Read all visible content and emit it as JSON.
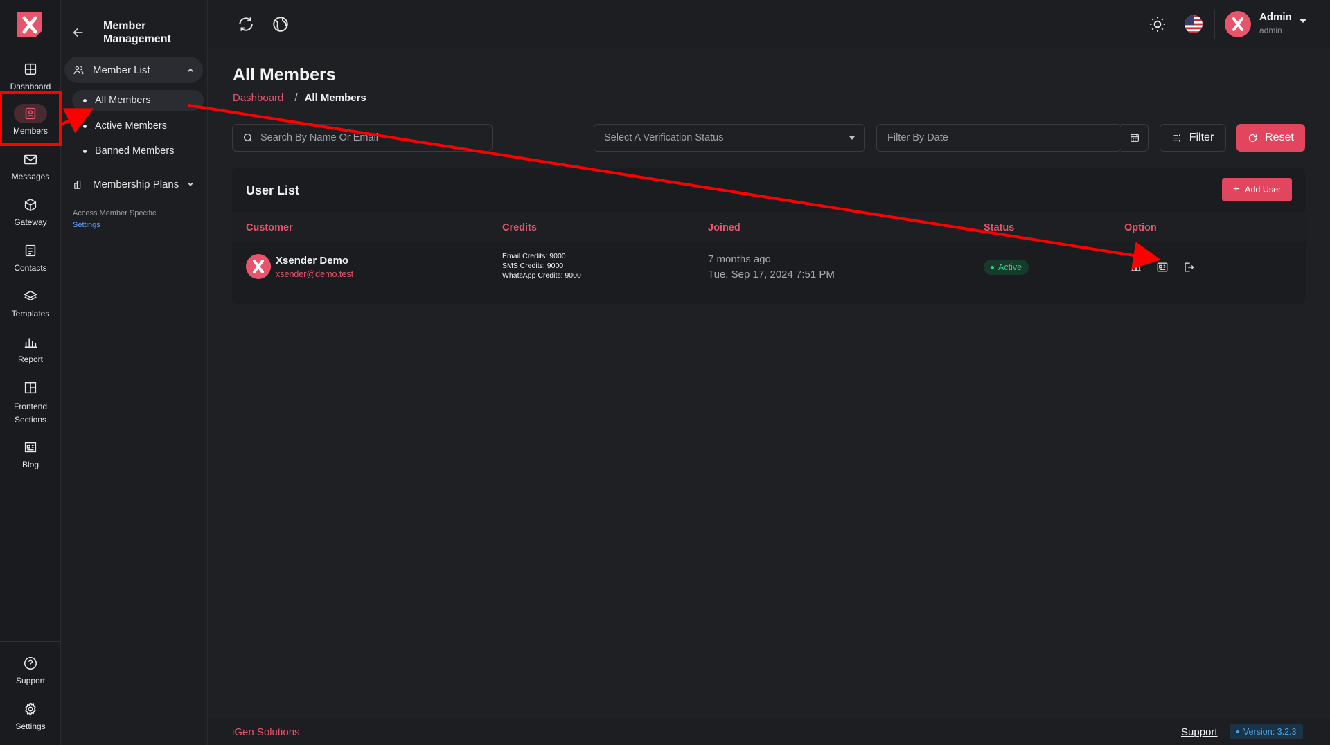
{
  "colors": {
    "accent": "#e8546b",
    "success": "#2fd08a",
    "info": "#4aa3e6",
    "annotation": "#ff0000"
  },
  "rail": {
    "items": [
      {
        "label": "Dashboard",
        "icon": "grid-icon"
      },
      {
        "label": "Members",
        "icon": "member-card-icon"
      },
      {
        "label": "Messages",
        "icon": "envelope-icon"
      },
      {
        "label": "Gateway",
        "icon": "cube-icon"
      },
      {
        "label": "Contacts",
        "icon": "contacts-icon"
      },
      {
        "label": "Templates",
        "icon": "layers-icon"
      },
      {
        "label": "Report",
        "icon": "bar-chart-icon"
      },
      {
        "label": "Frontend Sections",
        "icon": "layout-icon"
      },
      {
        "label": "Blog",
        "icon": "news-icon"
      }
    ],
    "bottom": [
      {
        "label": "Support",
        "icon": "help-icon"
      },
      {
        "label": "Settings",
        "icon": "gear-icon"
      }
    ]
  },
  "submenu": {
    "title": "Member Management",
    "member_list": "Member List",
    "links": [
      "All Members",
      "Active Members",
      "Banned Members"
    ],
    "membership_plans": "Membership Plans",
    "note": "Access Member Specific",
    "note_link": "Settings"
  },
  "topbar": {
    "user_name": "Admin",
    "user_role": "admin"
  },
  "main": {
    "title": "All Members",
    "breadcrumb": {
      "home": "Dashboard",
      "sep": "/",
      "current": "All Members"
    },
    "search_placeholder": "Search By Name Or Email",
    "verification_placeholder": "Select A Verification Status",
    "date_placeholder": "Filter By Date",
    "filter_label": "Filter",
    "reset_label": "Reset"
  },
  "table": {
    "title": "User List",
    "add_label": "Add User",
    "columns": [
      "Customer",
      "Credits",
      "Joined",
      "Status",
      "Option"
    ],
    "rows": [
      {
        "name": "Xsender Demo",
        "email": "xsender@demo.test",
        "credits": [
          "Email Credits: 9000",
          "SMS Credits: 9000",
          "WhatsApp Credits: 9000"
        ],
        "joined_relative": "7 months ago",
        "joined_date": "Tue, Sep 17, 2024 7:51 PM",
        "status": "Active"
      }
    ]
  },
  "footer": {
    "brand": "iGen Solutions",
    "support": "Support",
    "version": "Version: 3.2.3"
  }
}
